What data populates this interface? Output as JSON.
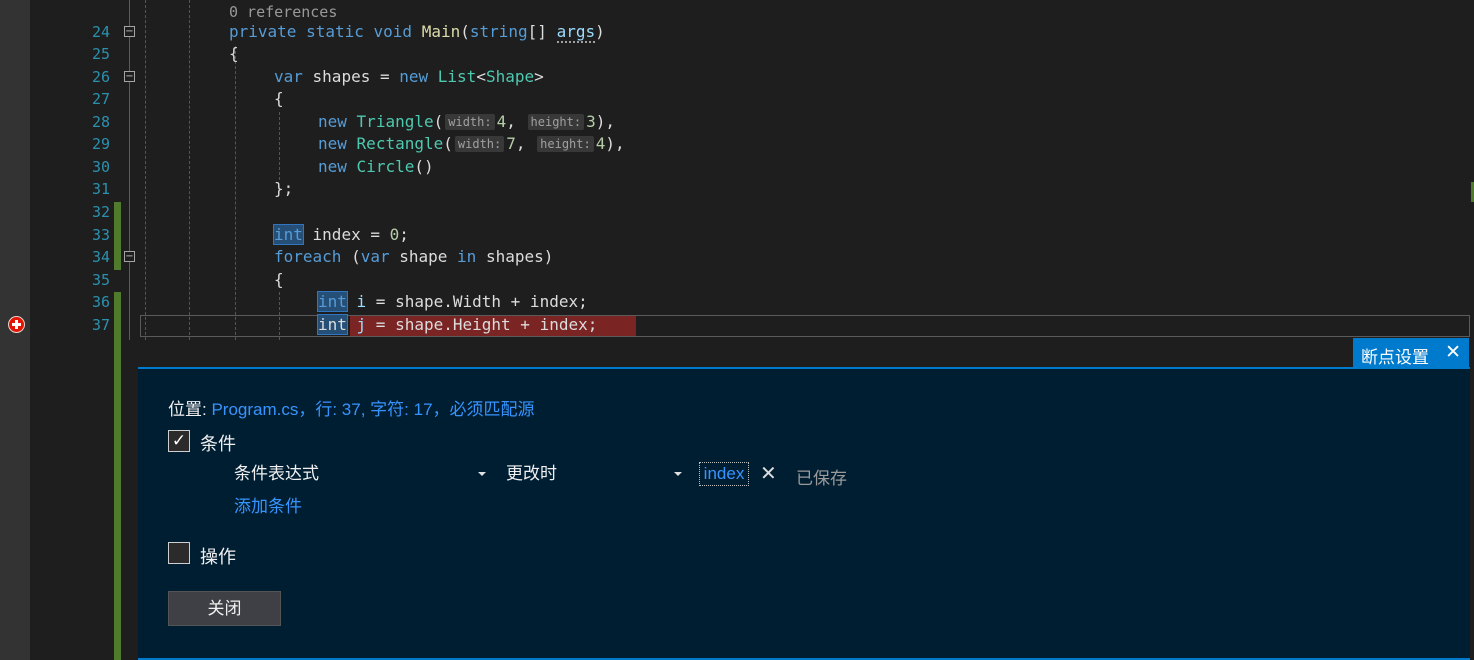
{
  "editor": {
    "codelens": "0 references",
    "lines": {
      "24": {
        "number": "24",
        "kw1": "private",
        "kw2": "static",
        "kw3": "void",
        "method": "Main",
        "open": "(",
        "type": "string",
        "brackets": "[] ",
        "param": "args",
        "close": ")"
      },
      "25": {
        "number": "25",
        "text": "{"
      },
      "26": {
        "number": "26",
        "kw": "var",
        "text1": " shapes = ",
        "kw2": "new",
        "type1": "List",
        "lt": "<",
        "type2": "Shape",
        "gt": ">"
      },
      "27": {
        "number": "27",
        "text": "{"
      },
      "28": {
        "number": "28",
        "kw": "new",
        "type": "Triangle",
        "open": "(",
        "hint1": "width:",
        "num1": "4",
        "sep": ", ",
        "hint2": "height:",
        "num2": "3",
        "close": "),"
      },
      "29": {
        "number": "29",
        "kw": "new",
        "type": "Rectangle",
        "open": "(",
        "hint1": "width:",
        "num1": "7",
        "sep": ", ",
        "hint2": "height:",
        "num2": "4",
        "close": "),"
      },
      "30": {
        "number": "30",
        "kw": "new",
        "type": "Circle",
        "rest": "()"
      },
      "31": {
        "number": "31",
        "text": "};"
      },
      "32": {
        "number": "32"
      },
      "33": {
        "number": "33",
        "kw": "int",
        "text": " index = ",
        "num": "0",
        "end": ";"
      },
      "34": {
        "number": "34",
        "kw": "foreach",
        "open": " (",
        "kw2": "var",
        "text": " shape ",
        "kw3": "in",
        "rest": " shapes)"
      },
      "35": {
        "number": "35",
        "text": "{"
      },
      "36": {
        "number": "36",
        "kw": "int",
        "var": " i",
        "rest": " = shape.Width + index;"
      },
      "37": {
        "number": "37",
        "kw": "int",
        "var": " j",
        "rest": " = shape.Height + index;"
      }
    }
  },
  "peek": {
    "tab_title": "断点设置",
    "close_glyph": "✕",
    "location_label": "位置: ",
    "location_value": "Program.cs，行: 37, 字符: 17，必须匹配源",
    "conditions": {
      "checked": true,
      "check_glyph": "✓",
      "label": "条件",
      "type_value": "条件表达式",
      "when_value": "更改时",
      "expression": "index",
      "remove_glyph": "✕",
      "status": "已保存",
      "add_label": "添加条件"
    },
    "actions": {
      "checked": false,
      "label": "操作"
    },
    "close_button": "关闭"
  },
  "colors": {
    "background": "#1e1e1e",
    "peek_background": "#001e32",
    "accent": "#007acc",
    "breakpoint": "#e51400",
    "change_bar": "#507a2c"
  },
  "icons": [
    "breakpoint-icon",
    "fold-minus-icon",
    "close-icon",
    "checkmark-icon",
    "chevron-down-icon"
  ]
}
